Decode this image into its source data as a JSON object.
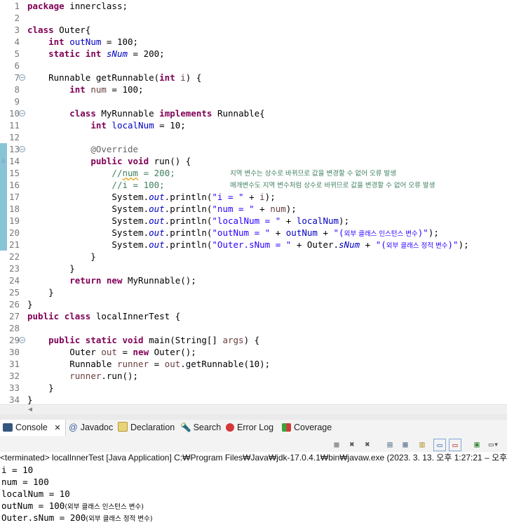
{
  "editor": {
    "lines": [
      {
        "n": "1",
        "segs": [
          {
            "c": "kw",
            "t": "package"
          },
          {
            "c": "",
            "t": " innerclass;"
          }
        ]
      },
      {
        "n": "2",
        "segs": []
      },
      {
        "n": "3",
        "segs": [
          {
            "c": "kw",
            "t": "class"
          },
          {
            "c": "",
            "t": " Outer{"
          }
        ]
      },
      {
        "n": "4",
        "segs": [
          {
            "c": "",
            "t": "    "
          },
          {
            "c": "kw",
            "t": "int"
          },
          {
            "c": "",
            "t": " "
          },
          {
            "c": "fld",
            "t": "outNum"
          },
          {
            "c": "",
            "t": " = 100;"
          }
        ]
      },
      {
        "n": "5",
        "segs": [
          {
            "c": "",
            "t": "    "
          },
          {
            "c": "kw",
            "t": "static"
          },
          {
            "c": "",
            "t": " "
          },
          {
            "c": "kw",
            "t": "int"
          },
          {
            "c": "",
            "t": " "
          },
          {
            "c": "sfld",
            "t": "sNum"
          },
          {
            "c": "",
            "t": " = 200;"
          }
        ]
      },
      {
        "n": "6",
        "segs": []
      },
      {
        "n": "7",
        "fold": true,
        "segs": [
          {
            "c": "",
            "t": "    Runnable getRunnable("
          },
          {
            "c": "kw",
            "t": "int"
          },
          {
            "c": "",
            "t": " "
          },
          {
            "c": "loc",
            "t": "i"
          },
          {
            "c": "",
            "t": ") {"
          }
        ]
      },
      {
        "n": "8",
        "segs": [
          {
            "c": "",
            "t": "        "
          },
          {
            "c": "kw",
            "t": "int"
          },
          {
            "c": "",
            "t": " "
          },
          {
            "c": "loc",
            "t": "num"
          },
          {
            "c": "",
            "t": " = 100;"
          }
        ]
      },
      {
        "n": "9",
        "segs": []
      },
      {
        "n": "10",
        "fold": true,
        "segs": [
          {
            "c": "",
            "t": "        "
          },
          {
            "c": "kw",
            "t": "class"
          },
          {
            "c": "",
            "t": " MyRunnable "
          },
          {
            "c": "kw",
            "t": "implements"
          },
          {
            "c": "",
            "t": " Runnable{"
          }
        ]
      },
      {
        "n": "11",
        "segs": [
          {
            "c": "",
            "t": "            "
          },
          {
            "c": "kw",
            "t": "int"
          },
          {
            "c": "",
            "t": " "
          },
          {
            "c": "fld",
            "t": "localNum"
          },
          {
            "c": "",
            "t": " = 10;"
          }
        ]
      },
      {
        "n": "12",
        "segs": []
      },
      {
        "n": "13",
        "fold": true,
        "ruler": true,
        "segs": [
          {
            "c": "",
            "t": "            "
          },
          {
            "c": "ann",
            "t": "@Override"
          }
        ]
      },
      {
        "n": "14",
        "ruler": true,
        "marker": true,
        "segs": [
          {
            "c": "",
            "t": "            "
          },
          {
            "c": "kw",
            "t": "public"
          },
          {
            "c": "",
            "t": " "
          },
          {
            "c": "kw",
            "t": "void"
          },
          {
            "c": "",
            "t": " run() {"
          }
        ]
      },
      {
        "n": "15",
        "ruler": true,
        "kc": "지역 변수는 상수로 바뀌므로 값을 변경할 수 없어 오류 발생",
        "segs": [
          {
            "c": "",
            "t": "                "
          },
          {
            "c": "cmt",
            "t": "//"
          },
          {
            "c": "cmt squig",
            "t": "num"
          },
          {
            "c": "cmt",
            "t": " = 200;"
          }
        ]
      },
      {
        "n": "16",
        "ruler": true,
        "kc": "매개변수도 지역 변수처럼 상수로 바뀌므로 값을 변경할 수 없어 오류 발생",
        "segs": [
          {
            "c": "",
            "t": "                "
          },
          {
            "c": "cmt",
            "t": "//i = 100;"
          }
        ]
      },
      {
        "n": "17",
        "ruler": true,
        "segs": [
          {
            "c": "",
            "t": "                System."
          },
          {
            "c": "sfld",
            "t": "out"
          },
          {
            "c": "",
            "t": ".println("
          },
          {
            "c": "str",
            "t": "\"i = \""
          },
          {
            "c": "",
            "t": " + "
          },
          {
            "c": "loc",
            "t": "i"
          },
          {
            "c": "",
            "t": ");"
          }
        ]
      },
      {
        "n": "18",
        "ruler": true,
        "segs": [
          {
            "c": "",
            "t": "                System."
          },
          {
            "c": "sfld",
            "t": "out"
          },
          {
            "c": "",
            "t": ".println("
          },
          {
            "c": "str",
            "t": "\"num = \""
          },
          {
            "c": "",
            "t": " + "
          },
          {
            "c": "loc",
            "t": "num"
          },
          {
            "c": "",
            "t": ");"
          }
        ]
      },
      {
        "n": "19",
        "ruler": true,
        "segs": [
          {
            "c": "",
            "t": "                System."
          },
          {
            "c": "sfld",
            "t": "out"
          },
          {
            "c": "",
            "t": ".println("
          },
          {
            "c": "str",
            "t": "\"localNum = \""
          },
          {
            "c": "",
            "t": " + "
          },
          {
            "c": "fld",
            "t": "localNum"
          },
          {
            "c": "",
            "t": ");"
          }
        ]
      },
      {
        "n": "20",
        "ruler": true,
        "segs": [
          {
            "c": "",
            "t": "                System."
          },
          {
            "c": "sfld",
            "t": "out"
          },
          {
            "c": "",
            "t": ".println("
          },
          {
            "c": "str",
            "t": "\"outNum = \""
          },
          {
            "c": "",
            "t": " + "
          },
          {
            "c": "fld",
            "t": "outNum"
          },
          {
            "c": "",
            "t": " + "
          },
          {
            "c": "str",
            "t": "\"("
          },
          {
            "c": "kstr",
            "t": "외부 클래스 인스턴스 변수"
          },
          {
            "c": "str",
            "t": ")\""
          },
          {
            "c": "",
            "t": ");"
          }
        ]
      },
      {
        "n": "21",
        "ruler": true,
        "segs": [
          {
            "c": "",
            "t": "                System."
          },
          {
            "c": "sfld",
            "t": "out"
          },
          {
            "c": "",
            "t": ".println("
          },
          {
            "c": "str",
            "t": "\"Outer.sNum = \""
          },
          {
            "c": "",
            "t": " + Outer."
          },
          {
            "c": "sfld",
            "t": "sNum"
          },
          {
            "c": "",
            "t": " + "
          },
          {
            "c": "str",
            "t": "\"("
          },
          {
            "c": "kstr",
            "t": "외부 클래스 정적 변수"
          },
          {
            "c": "str",
            "t": ")\""
          },
          {
            "c": "",
            "t": ");"
          }
        ]
      },
      {
        "n": "22",
        "segs": [
          {
            "c": "",
            "t": "            }"
          }
        ]
      },
      {
        "n": "23",
        "segs": [
          {
            "c": "",
            "t": "        }"
          }
        ]
      },
      {
        "n": "24",
        "segs": [
          {
            "c": "",
            "t": "        "
          },
          {
            "c": "kw",
            "t": "return"
          },
          {
            "c": "",
            "t": " "
          },
          {
            "c": "kw",
            "t": "new"
          },
          {
            "c": "",
            "t": " MyRunnable();"
          }
        ]
      },
      {
        "n": "25",
        "segs": [
          {
            "c": "",
            "t": "    }"
          }
        ]
      },
      {
        "n": "26",
        "segs": [
          {
            "c": "",
            "t": "}"
          }
        ]
      },
      {
        "n": "27",
        "segs": [
          {
            "c": "kw",
            "t": "public"
          },
          {
            "c": "",
            "t": " "
          },
          {
            "c": "kw",
            "t": "class"
          },
          {
            "c": "",
            "t": " localInnerTest {"
          }
        ]
      },
      {
        "n": "28",
        "segs": []
      },
      {
        "n": "29",
        "fold": true,
        "segs": [
          {
            "c": "",
            "t": "    "
          },
          {
            "c": "kw",
            "t": "public"
          },
          {
            "c": "",
            "t": " "
          },
          {
            "c": "kw",
            "t": "static"
          },
          {
            "c": "",
            "t": " "
          },
          {
            "c": "kw",
            "t": "void"
          },
          {
            "c": "",
            "t": " main(String[] "
          },
          {
            "c": "loc",
            "t": "args"
          },
          {
            "c": "",
            "t": ") {"
          }
        ]
      },
      {
        "n": "30",
        "segs": [
          {
            "c": "",
            "t": "        Outer "
          },
          {
            "c": "loc",
            "t": "out"
          },
          {
            "c": "",
            "t": " = "
          },
          {
            "c": "kw",
            "t": "new"
          },
          {
            "c": "",
            "t": " Outer();"
          }
        ]
      },
      {
        "n": "31",
        "segs": [
          {
            "c": "",
            "t": "        Runnable "
          },
          {
            "c": "loc",
            "t": "runner"
          },
          {
            "c": "",
            "t": " = "
          },
          {
            "c": "loc",
            "t": "out"
          },
          {
            "c": "",
            "t": ".getRunnable(10);"
          }
        ]
      },
      {
        "n": "32",
        "segs": [
          {
            "c": "",
            "t": "        "
          },
          {
            "c": "loc",
            "t": "runner"
          },
          {
            "c": "",
            "t": ".run();"
          }
        ]
      },
      {
        "n": "33",
        "segs": [
          {
            "c": "",
            "t": "    }"
          }
        ]
      },
      {
        "n": "34",
        "segs": [
          {
            "c": "",
            "t": "}"
          }
        ]
      }
    ]
  },
  "views": {
    "tabs": [
      {
        "id": "console",
        "label": "Console",
        "icon": "console-icon",
        "active": true,
        "close": "✕"
      },
      {
        "id": "javadoc",
        "label": "Javadoc",
        "icon": "at-icon"
      },
      {
        "id": "declaration",
        "label": "Declaration",
        "icon": "declaration-icon"
      },
      {
        "id": "search",
        "label": "Search",
        "icon": "search-icon"
      },
      {
        "id": "errorlog",
        "label": "Error Log",
        "icon": "error-log-icon"
      },
      {
        "id": "coverage",
        "label": "Coverage",
        "icon": "coverage-icon"
      }
    ]
  },
  "console": {
    "terminated": "<terminated> localInnerTest [Java Application] C:₩Program Files₩Java₩jdk-17.0.4.1₩bin₩javaw.exe  (2023. 3. 13. 오후 1:27:21 – 오후",
    "output": [
      {
        "t": "i = 10"
      },
      {
        "t": "num = 100"
      },
      {
        "t": "localNum = 10"
      },
      {
        "t": "outNum = 100",
        "k": "(외부 클래스 인스턴스 변수)"
      },
      {
        "t": "Outer.sNum = 200",
        "k": "(외부 클래스 정적 변수)"
      }
    ]
  },
  "colors": {
    "keyword": "#7f0055",
    "field": "#0000c0",
    "string": "#2a00ff",
    "comment": "#3f7f5f",
    "ruler": "#89c4d6"
  }
}
